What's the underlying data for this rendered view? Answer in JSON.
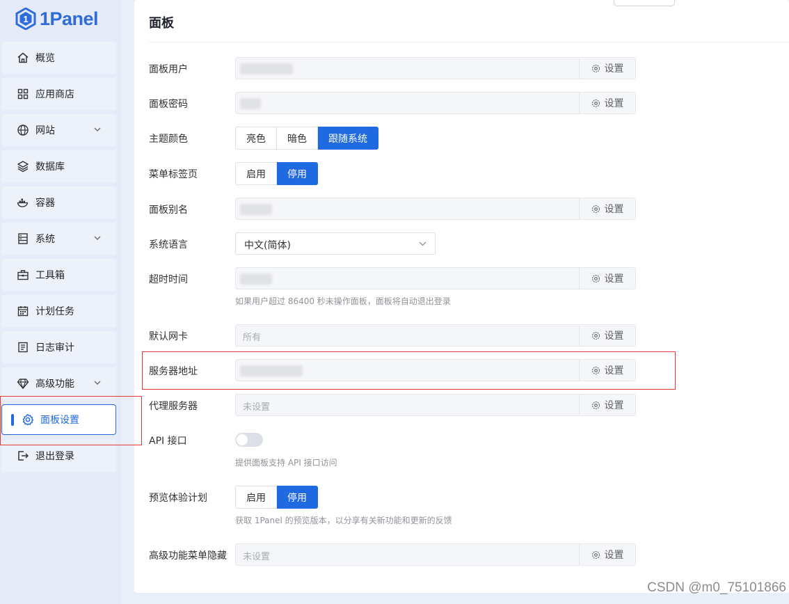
{
  "brand": {
    "name": "1Panel",
    "accent": "#1f6ae0"
  },
  "sidebar": {
    "items": [
      {
        "label": "概览",
        "icon": "home-icon",
        "expandable": false
      },
      {
        "label": "应用商店",
        "icon": "grid-icon",
        "expandable": false
      },
      {
        "label": "网站",
        "icon": "globe-icon",
        "expandable": true
      },
      {
        "label": "数据库",
        "icon": "layers-icon",
        "expandable": false
      },
      {
        "label": "容器",
        "icon": "docker-icon",
        "expandable": false
      },
      {
        "label": "系统",
        "icon": "server-icon",
        "expandable": true
      },
      {
        "label": "工具箱",
        "icon": "toolbox-icon",
        "expandable": false
      },
      {
        "label": "计划任务",
        "icon": "calendar-icon",
        "expandable": false
      },
      {
        "label": "日志审计",
        "icon": "log-icon",
        "expandable": false
      },
      {
        "label": "高级功能",
        "icon": "diamond-icon",
        "expandable": true
      },
      {
        "label": "面板设置",
        "icon": "gear-icon",
        "expandable": false,
        "active": true
      },
      {
        "label": "退出登录",
        "icon": "logout-icon",
        "expandable": false
      }
    ]
  },
  "main": {
    "title": "面板",
    "set_label": "设置",
    "fields": {
      "panel_user": {
        "label": "面板用户"
      },
      "panel_password": {
        "label": "面板密码"
      },
      "theme": {
        "label": "主题颜色",
        "options": [
          "亮色",
          "暗色",
          "跟随系统"
        ],
        "selected": "跟随系统"
      },
      "menu_tabs": {
        "label": "菜单标签页",
        "options": [
          "启用",
          "停用"
        ],
        "selected": "停用"
      },
      "panel_alias": {
        "label": "面板别名"
      },
      "language": {
        "label": "系统语言",
        "value": "中文(简体)"
      },
      "timeout": {
        "label": "超时时间",
        "hint": "如果用户超过 86400 秒未操作面板，面板将自动退出登录"
      },
      "default_nic": {
        "label": "默认网卡",
        "value": "所有"
      },
      "server_address": {
        "label": "服务器地址"
      },
      "proxy": {
        "label": "代理服务器",
        "value": "未设置"
      },
      "api": {
        "label": "API 接口",
        "enabled": false,
        "hint": "提供面板支持 API 接口访问"
      },
      "preview": {
        "label": "预览体验计划",
        "options": [
          "启用",
          "停用"
        ],
        "selected": "停用",
        "hint": "获取 1Panel 的预览版本，以分享有关新功能和更新的反馈"
      },
      "hide_menu": {
        "label": "高级功能菜单隐藏",
        "value": "未设置"
      }
    }
  },
  "watermark": "CSDN @m0_75101866"
}
